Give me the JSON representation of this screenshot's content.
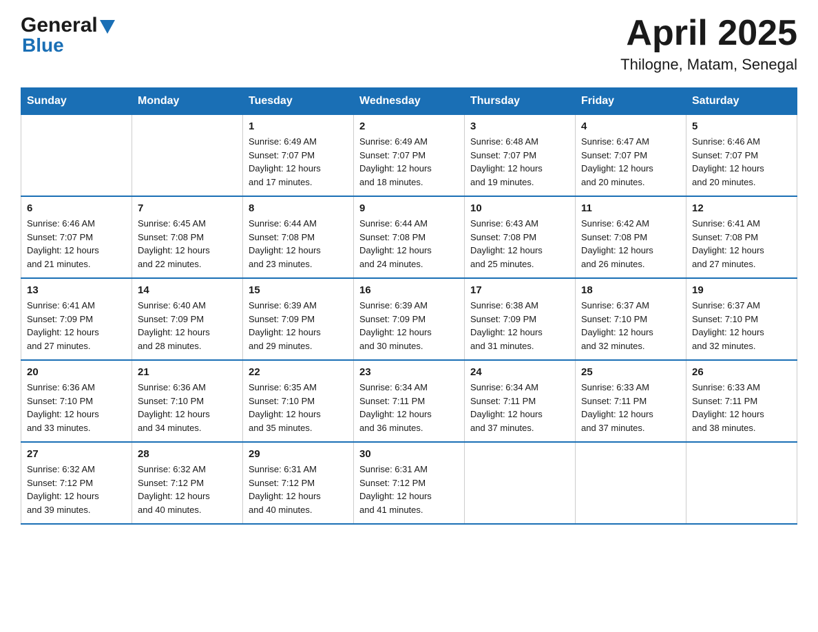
{
  "header": {
    "logo_general": "General",
    "logo_blue": "Blue",
    "title": "April 2025",
    "subtitle": "Thilogne, Matam, Senegal"
  },
  "calendar": {
    "days_of_week": [
      "Sunday",
      "Monday",
      "Tuesday",
      "Wednesday",
      "Thursday",
      "Friday",
      "Saturday"
    ],
    "weeks": [
      [
        {
          "day": "",
          "info": ""
        },
        {
          "day": "",
          "info": ""
        },
        {
          "day": "1",
          "info": "Sunrise: 6:49 AM\nSunset: 7:07 PM\nDaylight: 12 hours\nand 17 minutes."
        },
        {
          "day": "2",
          "info": "Sunrise: 6:49 AM\nSunset: 7:07 PM\nDaylight: 12 hours\nand 18 minutes."
        },
        {
          "day": "3",
          "info": "Sunrise: 6:48 AM\nSunset: 7:07 PM\nDaylight: 12 hours\nand 19 minutes."
        },
        {
          "day": "4",
          "info": "Sunrise: 6:47 AM\nSunset: 7:07 PM\nDaylight: 12 hours\nand 20 minutes."
        },
        {
          "day": "5",
          "info": "Sunrise: 6:46 AM\nSunset: 7:07 PM\nDaylight: 12 hours\nand 20 minutes."
        }
      ],
      [
        {
          "day": "6",
          "info": "Sunrise: 6:46 AM\nSunset: 7:07 PM\nDaylight: 12 hours\nand 21 minutes."
        },
        {
          "day": "7",
          "info": "Sunrise: 6:45 AM\nSunset: 7:08 PM\nDaylight: 12 hours\nand 22 minutes."
        },
        {
          "day": "8",
          "info": "Sunrise: 6:44 AM\nSunset: 7:08 PM\nDaylight: 12 hours\nand 23 minutes."
        },
        {
          "day": "9",
          "info": "Sunrise: 6:44 AM\nSunset: 7:08 PM\nDaylight: 12 hours\nand 24 minutes."
        },
        {
          "day": "10",
          "info": "Sunrise: 6:43 AM\nSunset: 7:08 PM\nDaylight: 12 hours\nand 25 minutes."
        },
        {
          "day": "11",
          "info": "Sunrise: 6:42 AM\nSunset: 7:08 PM\nDaylight: 12 hours\nand 26 minutes."
        },
        {
          "day": "12",
          "info": "Sunrise: 6:41 AM\nSunset: 7:08 PM\nDaylight: 12 hours\nand 27 minutes."
        }
      ],
      [
        {
          "day": "13",
          "info": "Sunrise: 6:41 AM\nSunset: 7:09 PM\nDaylight: 12 hours\nand 27 minutes."
        },
        {
          "day": "14",
          "info": "Sunrise: 6:40 AM\nSunset: 7:09 PM\nDaylight: 12 hours\nand 28 minutes."
        },
        {
          "day": "15",
          "info": "Sunrise: 6:39 AM\nSunset: 7:09 PM\nDaylight: 12 hours\nand 29 minutes."
        },
        {
          "day": "16",
          "info": "Sunrise: 6:39 AM\nSunset: 7:09 PM\nDaylight: 12 hours\nand 30 minutes."
        },
        {
          "day": "17",
          "info": "Sunrise: 6:38 AM\nSunset: 7:09 PM\nDaylight: 12 hours\nand 31 minutes."
        },
        {
          "day": "18",
          "info": "Sunrise: 6:37 AM\nSunset: 7:10 PM\nDaylight: 12 hours\nand 32 minutes."
        },
        {
          "day": "19",
          "info": "Sunrise: 6:37 AM\nSunset: 7:10 PM\nDaylight: 12 hours\nand 32 minutes."
        }
      ],
      [
        {
          "day": "20",
          "info": "Sunrise: 6:36 AM\nSunset: 7:10 PM\nDaylight: 12 hours\nand 33 minutes."
        },
        {
          "day": "21",
          "info": "Sunrise: 6:36 AM\nSunset: 7:10 PM\nDaylight: 12 hours\nand 34 minutes."
        },
        {
          "day": "22",
          "info": "Sunrise: 6:35 AM\nSunset: 7:10 PM\nDaylight: 12 hours\nand 35 minutes."
        },
        {
          "day": "23",
          "info": "Sunrise: 6:34 AM\nSunset: 7:11 PM\nDaylight: 12 hours\nand 36 minutes."
        },
        {
          "day": "24",
          "info": "Sunrise: 6:34 AM\nSunset: 7:11 PM\nDaylight: 12 hours\nand 37 minutes."
        },
        {
          "day": "25",
          "info": "Sunrise: 6:33 AM\nSunset: 7:11 PM\nDaylight: 12 hours\nand 37 minutes."
        },
        {
          "day": "26",
          "info": "Sunrise: 6:33 AM\nSunset: 7:11 PM\nDaylight: 12 hours\nand 38 minutes."
        }
      ],
      [
        {
          "day": "27",
          "info": "Sunrise: 6:32 AM\nSunset: 7:12 PM\nDaylight: 12 hours\nand 39 minutes."
        },
        {
          "day": "28",
          "info": "Sunrise: 6:32 AM\nSunset: 7:12 PM\nDaylight: 12 hours\nand 40 minutes."
        },
        {
          "day": "29",
          "info": "Sunrise: 6:31 AM\nSunset: 7:12 PM\nDaylight: 12 hours\nand 40 minutes."
        },
        {
          "day": "30",
          "info": "Sunrise: 6:31 AM\nSunset: 7:12 PM\nDaylight: 12 hours\nand 41 minutes."
        },
        {
          "day": "",
          "info": ""
        },
        {
          "day": "",
          "info": ""
        },
        {
          "day": "",
          "info": ""
        }
      ]
    ]
  }
}
